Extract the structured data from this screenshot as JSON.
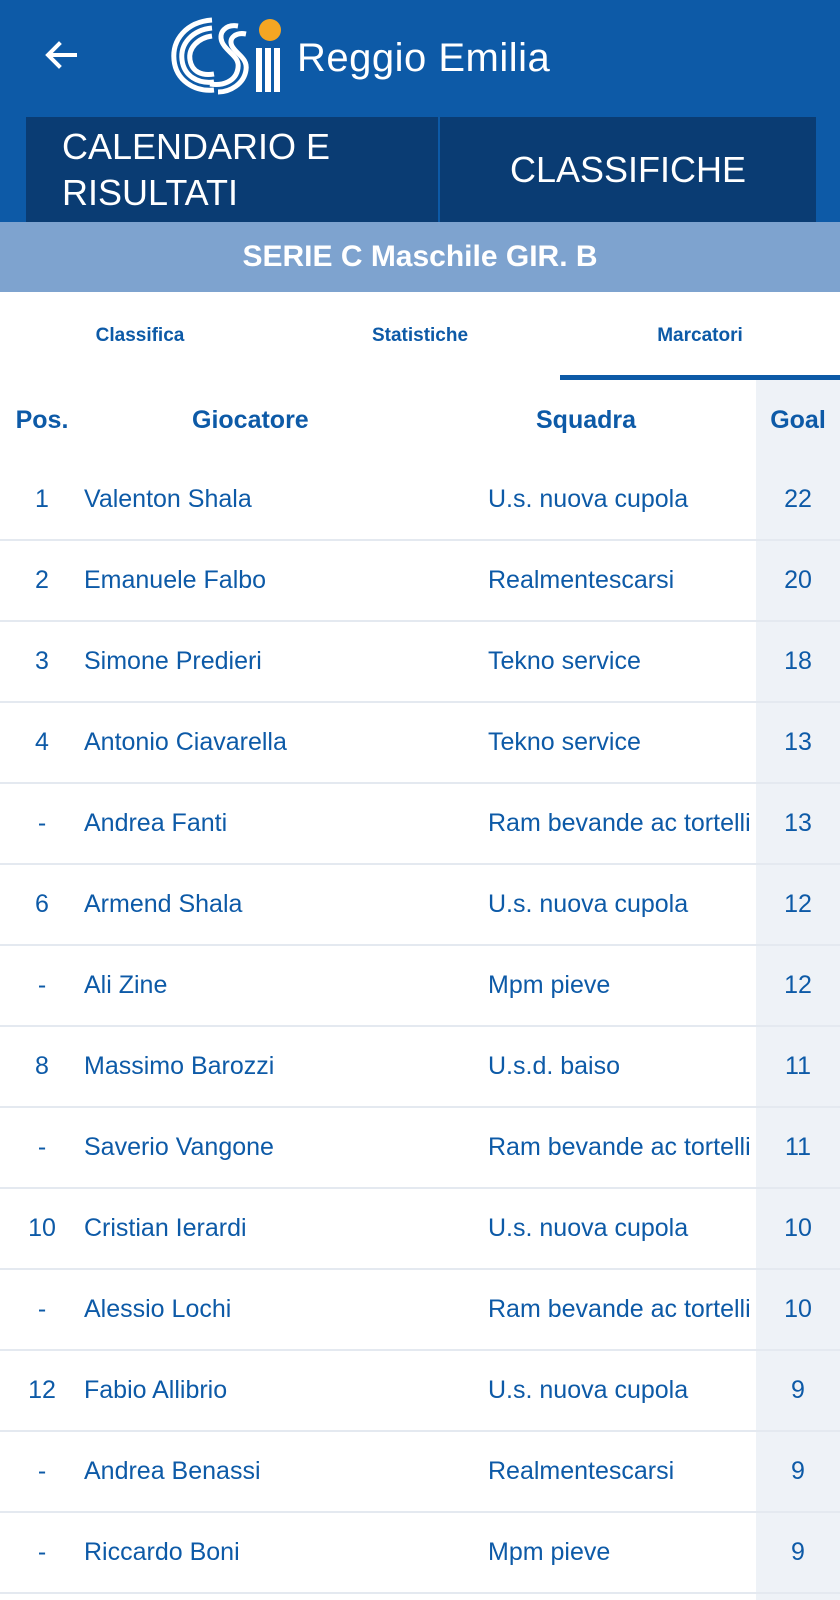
{
  "header": {
    "brand": "Reggio Emilia",
    "back_icon": "arrow-left-icon",
    "logo": "csi-logo",
    "tabs": [
      "CALENDARIO E RISULTATI",
      "CLASSIFICHE"
    ]
  },
  "serie": "SERIE C Maschile GIR. B",
  "subtabs": [
    "Classifica",
    "Statistiche",
    "Marcatori"
  ],
  "active_subtab": "Marcatori",
  "table": {
    "headers": {
      "pos": "Pos.",
      "player": "Giocatore",
      "team": "Squadra",
      "goal": "Goal"
    },
    "rows": [
      {
        "pos": "1",
        "player": "Valenton Shala",
        "team": "U.s. nuova cupola",
        "goal": "22"
      },
      {
        "pos": "2",
        "player": "Emanuele Falbo",
        "team": "Realmentescarsi",
        "goal": "20"
      },
      {
        "pos": "3",
        "player": "Simone Predieri",
        "team": "Tekno service",
        "goal": "18"
      },
      {
        "pos": "4",
        "player": "Antonio Ciavarella",
        "team": "Tekno service",
        "goal": "13"
      },
      {
        "pos": "-",
        "player": "Andrea Fanti",
        "team": "Ram bevande ac tortelli",
        "goal": "13"
      },
      {
        "pos": "6",
        "player": "Armend Shala",
        "team": "U.s. nuova cupola",
        "goal": "12"
      },
      {
        "pos": "-",
        "player": "Ali Zine",
        "team": "Mpm pieve",
        "goal": "12"
      },
      {
        "pos": "8",
        "player": "Massimo Barozzi",
        "team": "U.s.d. baiso",
        "goal": "11"
      },
      {
        "pos": "-",
        "player": "Saverio Vangone",
        "team": "Ram bevande ac tortelli",
        "goal": "11"
      },
      {
        "pos": "10",
        "player": "Cristian Ierardi",
        "team": "U.s. nuova cupola",
        "goal": "10"
      },
      {
        "pos": "-",
        "player": "Alessio Lochi",
        "team": "Ram bevande ac tortelli",
        "goal": "10"
      },
      {
        "pos": "12",
        "player": "Fabio Allibrio",
        "team": "U.s. nuova cupola",
        "goal": "9"
      },
      {
        "pos": "-",
        "player": "Andrea Benassi",
        "team": "Realmentescarsi",
        "goal": "9"
      },
      {
        "pos": "-",
        "player": "Riccardo Boni",
        "team": "Mpm pieve",
        "goal": "9"
      }
    ]
  },
  "colors": {
    "primary": "#0d5aa7",
    "dark": "#0a3c73",
    "serie_bg": "#7ea3cf",
    "goal_bg": "#eef2f7"
  }
}
